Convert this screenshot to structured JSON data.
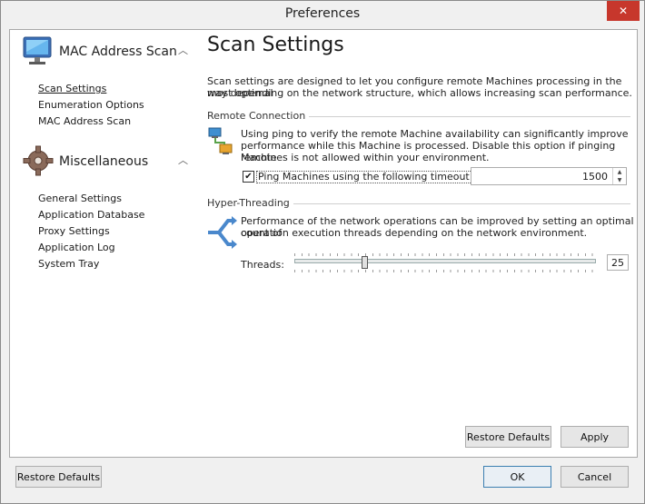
{
  "window": {
    "title": "Preferences",
    "close_glyph": "✕"
  },
  "sidebar": {
    "groups": [
      {
        "label": "MAC Address Scan",
        "icon": "monitor-icon",
        "items": [
          "Scan Settings",
          "Enumeration Options",
          "MAC Address Scan"
        ]
      },
      {
        "label": "Miscellaneous",
        "icon": "gear-icon",
        "items": [
          "General Settings",
          "Application Database",
          "Proxy Settings",
          "Application Log",
          "System Tray"
        ]
      }
    ],
    "active_item": "Scan Settings"
  },
  "content": {
    "title": "Scan Settings",
    "description_1": "Scan settings are designed to let you configure remote Machines processing in the most optimal",
    "description_2": "way depending on the network structure, which allows increasing scan performance.",
    "remote": {
      "section_title": "Remote Connection",
      "text_1": "Using ping to verify the remote Machine availability can significantly improve",
      "text_2": "performance while this Machine is processed. Disable this option if pinging remote",
      "text_3": "Machines is not allowed within your environment.",
      "checkbox_label": "Ping Machines using the following timeout (ms.):",
      "checked": true,
      "timeout_value": "1500"
    },
    "threading": {
      "section_title": "Hyper-Threading",
      "text_1": "Performance of the network operations can be improved by setting an optimal count of",
      "text_2": "operation execution threads depending on the network environment.",
      "threads_label": "Threads:",
      "threads_value": "25"
    },
    "restore_defaults_label": "Restore Defaults",
    "apply_label": "Apply"
  },
  "footer": {
    "restore_defaults_label": "Restore Defaults",
    "ok_label": "OK",
    "cancel_label": "Cancel"
  }
}
